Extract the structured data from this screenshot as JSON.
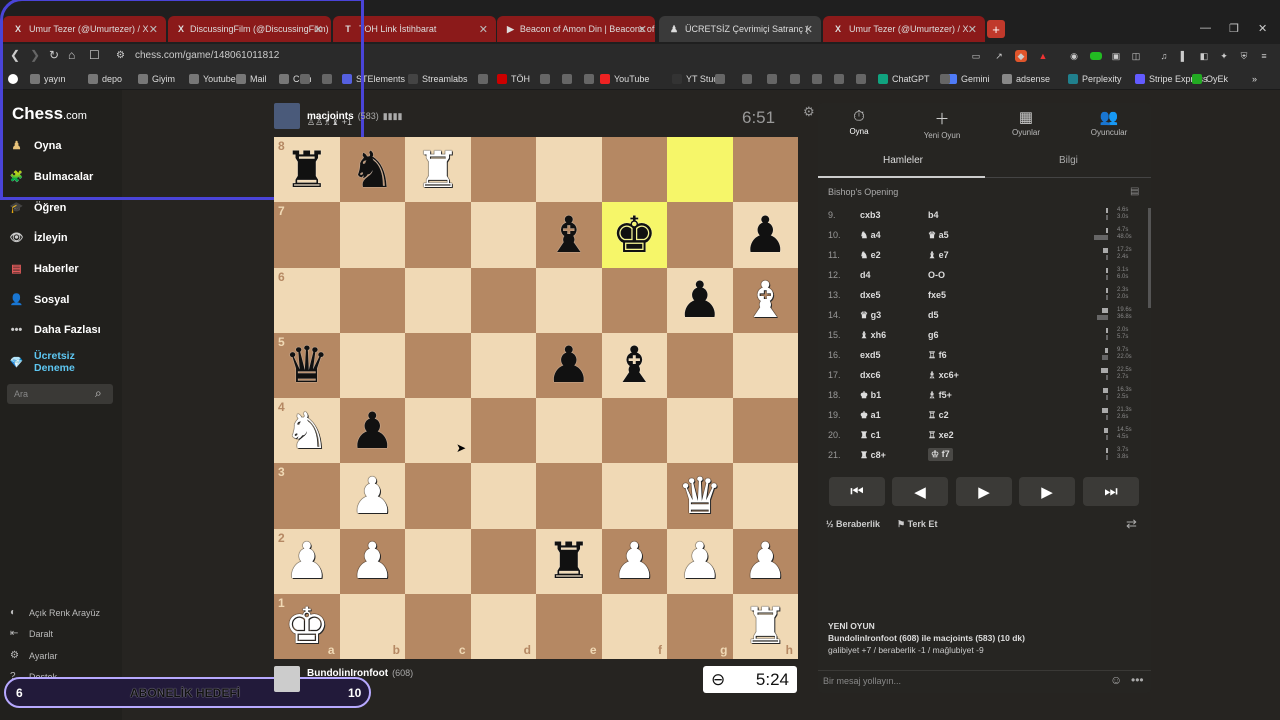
{
  "browser": {
    "tabs": [
      {
        "label": "Umur Tezer (@Umurtezer) / X",
        "icon": "X"
      },
      {
        "label": "DiscussingFilm (@DiscussingFilm) / X",
        "icon": "X"
      },
      {
        "label": "TOH Link İstihbarat",
        "icon": "T"
      },
      {
        "label": "Beacon of Amon Din | Beacons of Mi",
        "icon": "▶"
      },
      {
        "label": "ÜCRETSİZ Çevrimiçi Satranç (",
        "icon": "♟"
      },
      {
        "label": "Umur Tezer (@Umurtezer) / X",
        "icon": "X"
      }
    ],
    "new_tab": "+",
    "url": "chess.com/game/148061011812",
    "bookmarks": [
      "yayın",
      "depo",
      "Giyim",
      "Youtube",
      "Mail",
      "Coin",
      "STElements",
      "Streamlabs",
      "TÖH",
      "YouTube",
      "YT Studio",
      "ChatGPT",
      "Gemini",
      "adsense",
      "Perplexity",
      "Stripe Express",
      "OyEk"
    ]
  },
  "sidebar": {
    "logo": "Chess",
    "logo_suffix": ".com",
    "nav": [
      "Oyna",
      "Bulmacalar",
      "Öğren",
      "İzleyin",
      "Haberler",
      "Sosyal",
      "Daha Fazlası",
      "Ücretsiz Deneme"
    ],
    "search_placeholder": "Ara",
    "bottom": [
      "Açık Renk Arayüz",
      "Daralt",
      "Ayarlar",
      "Destek"
    ]
  },
  "goal": {
    "left": "6",
    "label": "ABONELİK HEDEFİ",
    "right": "10"
  },
  "top_player": {
    "name": "macjoints",
    "rating": "(583)",
    "material": "+1",
    "clock": "6:51"
  },
  "bottom_player": {
    "name": "BundolinIronfoot",
    "rating": "(608)",
    "clock": "5:24"
  },
  "board": {
    "rows": [
      [
        "br",
        "bn",
        "wr",
        "",
        "",
        "",
        "",
        ""
      ],
      [
        "",
        "",
        "",
        "",
        "bb",
        "bk",
        "",
        "bp"
      ],
      [
        "",
        "",
        "",
        "",
        "",
        "",
        "bp",
        "wb"
      ],
      [
        "bq",
        "",
        "",
        "",
        "bp",
        "bb",
        "",
        ""
      ],
      [
        "wn",
        "bp",
        "",
        "",
        "",
        "",
        "",
        ""
      ],
      [
        "",
        "wp",
        "",
        "",
        "",
        "",
        "wq",
        ""
      ],
      [
        "wp",
        "wp",
        "",
        "",
        "br",
        "wp",
        "wp",
        "wp"
      ],
      [
        "wk",
        "",
        "",
        "",
        "",
        "",
        "",
        "wr"
      ]
    ],
    "highlight": [
      "g8",
      "f7"
    ],
    "ranks": [
      "8",
      "7",
      "6",
      "5",
      "4",
      "3",
      "2",
      "1"
    ],
    "files": [
      "a",
      "b",
      "c",
      "d",
      "e",
      "f",
      "g",
      "h"
    ]
  },
  "panel": {
    "tabs": [
      {
        "label": "Oyna",
        "icon": "⏱"
      },
      {
        "label": "Yeni Oyun",
        "icon": "＋"
      },
      {
        "label": "Oyunlar",
        "icon": "▦"
      },
      {
        "label": "Oyuncular",
        "icon": "👥"
      }
    ],
    "subtabs": [
      "Hamleler",
      "Bilgi"
    ],
    "opening": "Bishop's Opening",
    "moves": [
      {
        "n": "9.",
        "w": "cxb3",
        "b": "b4",
        "wt": "4.6s",
        "bt": "3.0s",
        "wf": 0.1,
        "bf": 0.06
      },
      {
        "n": "10.",
        "w": "♞ a4",
        "b": "♛ a5",
        "wt": "4.7s",
        "bt": "48.0s",
        "wf": 0.1,
        "bf": 1.0
      },
      {
        "n": "11.",
        "w": "♞ e2",
        "b": "♝ e7",
        "wt": "17.2s",
        "bt": "2.4s",
        "wf": 0.35,
        "bf": 0.05
      },
      {
        "n": "12.",
        "w": "d4",
        "b": "O-O",
        "wt": "3.1s",
        "bt": "6.0s",
        "wf": 0.07,
        "bf": 0.13
      },
      {
        "n": "13.",
        "w": "dxe5",
        "b": "fxe5",
        "wt": "2.3s",
        "bt": "2.0s",
        "wf": 0.05,
        "bf": 0.04
      },
      {
        "n": "14.",
        "w": "♛ g3",
        "b": "d5",
        "wt": "19.6s",
        "bt": "36.8s",
        "wf": 0.4,
        "bf": 0.77
      },
      {
        "n": "15.",
        "w": "♝ xh6",
        "b": "g6",
        "wt": "2.0s",
        "bt": "5.7s",
        "wf": 0.04,
        "bf": 0.12
      },
      {
        "n": "16.",
        "w": "exd5",
        "b": "♖ f6",
        "wt": "9.7s",
        "bt": "22.0s",
        "wf": 0.2,
        "bf": 0.46
      },
      {
        "n": "17.",
        "w": "dxc6",
        "b": "♗ xc6+",
        "wt": "22.5s",
        "bt": "2.7s",
        "wf": 0.47,
        "bf": 0.06
      },
      {
        "n": "18.",
        "w": "♚ b1",
        "b": "♗ f5+",
        "wt": "16.3s",
        "bt": "2.5s",
        "wf": 0.34,
        "bf": 0.05
      },
      {
        "n": "19.",
        "w": "♚ a1",
        "b": "♖ c2",
        "wt": "21.3s",
        "bt": "2.6s",
        "wf": 0.44,
        "bf": 0.05
      },
      {
        "n": "20.",
        "w": "♜ c1",
        "b": "♖ xe2",
        "wt": "14.5s",
        "bt": "4.5s",
        "wf": 0.3,
        "bf": 0.09
      },
      {
        "n": "21.",
        "w": "♜ c8+",
        "b": "♔ f7",
        "wt": "3.7s",
        "bt": "3.8s",
        "wf": 0.08,
        "bf": 0.08
      }
    ],
    "controls": [
      "⏮",
      "◀",
      "▶",
      "▶",
      "⏭"
    ],
    "draw": "Beraberlik",
    "resign": "Terk Et",
    "new_game_title": "YENİ OYUN",
    "new_game_line": "BundolinIronfoot (608) ile macjoints (583) (10 dk)",
    "record": "galibiyet +7 / beraberlik -1 / mağlubiyet -9",
    "chat_placeholder": "Bir mesaj yollayın..."
  }
}
